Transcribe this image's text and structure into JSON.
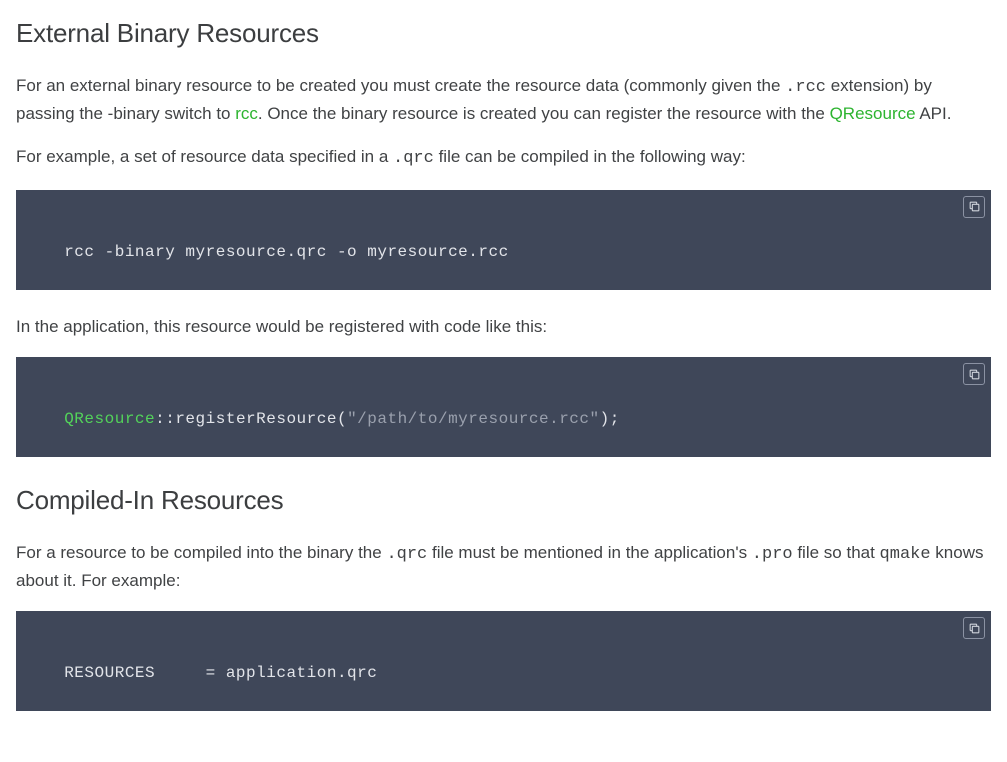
{
  "section1": {
    "heading": "External Binary Resources",
    "p1_a": "For an external binary resource to be created you must create the resource data (commonly given the ",
    "p1_code1": ".rcc",
    "p1_b": " extension) by passing the -binary switch to ",
    "p1_link1": "rcc",
    "p1_c": ". Once the binary resource is created you can register the resource with the ",
    "p1_link2": "QResource",
    "p1_d": " API.",
    "p2_a": "For example, a set of resource data specified in a ",
    "p2_code1": ".qrc",
    "p2_b": " file can be compiled in the following way:",
    "code1": "rcc -binary myresource.qrc -o myresource.rcc",
    "p3": "In the application, this resource would be registered with code like this:",
    "code2_type": "QResource",
    "code2_mid": "::registerResource(",
    "code2_str": "\"/path/to/myresource.rcc\"",
    "code2_end": ");"
  },
  "section2": {
    "heading": "Compiled-In Resources",
    "p1_a": "For a resource to be compiled into the binary the ",
    "p1_code1": ".qrc",
    "p1_b": " file must be mentioned in the application's ",
    "p1_code2": ".pro",
    "p1_c": " file so that ",
    "p1_code3": "qmake",
    "p1_d": " knows about it. For example:",
    "code1": "RESOURCES     = application.qrc"
  }
}
